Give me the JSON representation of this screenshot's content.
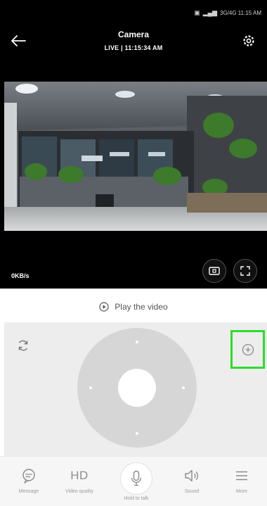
{
  "status_bar": {
    "time": "3G/4G 11:15 AM",
    "battery_label": ""
  },
  "header": {
    "title": "Camera",
    "subtitle": "LIVE | 11:15:34 AM"
  },
  "video": {
    "bitrate": "0KB/s"
  },
  "playback": {
    "label": "Play the video"
  },
  "tabs": [
    {
      "label": "Message"
    },
    {
      "label": "HD",
      "sub": "Video quality"
    },
    {
      "label": "Hold to talk"
    },
    {
      "label": "Sound"
    },
    {
      "label": "More"
    }
  ],
  "colors": {
    "highlight": "#2bdd2b",
    "top_bg": "#000000",
    "panel_bg": "#ededed",
    "joystick": "#d6d6d6"
  },
  "icons": [
    "back-arrow-icon",
    "gear-icon",
    "screenshot-icon",
    "fullscreen-icon",
    "play-circle-icon",
    "rotate-icon",
    "zoom-in-icon",
    "message-icon",
    "microphone-icon",
    "speaker-icon",
    "menu-icon"
  ]
}
